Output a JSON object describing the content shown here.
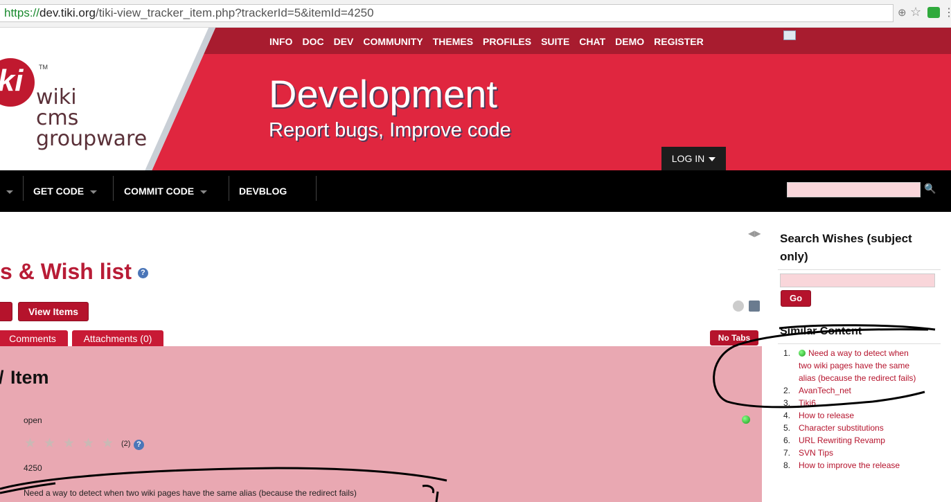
{
  "browser": {
    "url_proto": "https://",
    "url_host": "dev.tiki.org",
    "url_path": "/tiki-view_tracker_item.php?trackerId=5&itemId=4250"
  },
  "header": {
    "logo_lines": [
      "wiki",
      "cms",
      "groupware"
    ],
    "logo_mark": "ki",
    "logo_tm": "TM",
    "top_nav": [
      "INFO",
      "DOC",
      "DEV",
      "COMMUNITY",
      "THEMES",
      "PROFILES",
      "SUITE",
      "CHAT",
      "DEMO",
      "REGISTER"
    ],
    "title": "Development",
    "subtitle": "Report bugs, Improve code",
    "login_label": "LOG IN"
  },
  "main_nav": {
    "items": [
      "GET CODE",
      "COMMIT CODE",
      "DEVBLOG"
    ]
  },
  "main": {
    "page_title": "s & Wish list",
    "view_items_label": "View Items",
    "tabs": [
      "Comments",
      "Attachments (0)"
    ],
    "no_tabs_label": "No Tabs",
    "item_heading": "Item",
    "status_text": "open",
    "rating_count": "(2)",
    "item_id": "4250",
    "summary": "Need a way to detect when two wiki pages have the same alias (because the redirect fails)",
    "rating_stars": 5
  },
  "sidebar": {
    "search_title": "Search Wishes (subject only)",
    "go_label": "Go",
    "similar_title": "Similar Content",
    "similar_items": [
      {
        "num": "1.",
        "label": "Need a way to detect when two wiki pages have the same alias (because the redirect fails)"
      },
      {
        "num": "2.",
        "label": "AvanTech_net"
      },
      {
        "num": "3.",
        "label": "Tiki6"
      },
      {
        "num": "4.",
        "label": "How to release"
      },
      {
        "num": "5.",
        "label": "Character substitutions"
      },
      {
        "num": "6.",
        "label": "URL Rewriting Revamp"
      },
      {
        "num": "7.",
        "label": "SVN Tips"
      },
      {
        "num": "8.",
        "label": "How to improve the release"
      }
    ]
  },
  "colors": {
    "brand_red": "#e0263f",
    "dark_red": "#a81c2f",
    "button_red": "#b5132c",
    "panel_pink": "#e9a8b2"
  }
}
